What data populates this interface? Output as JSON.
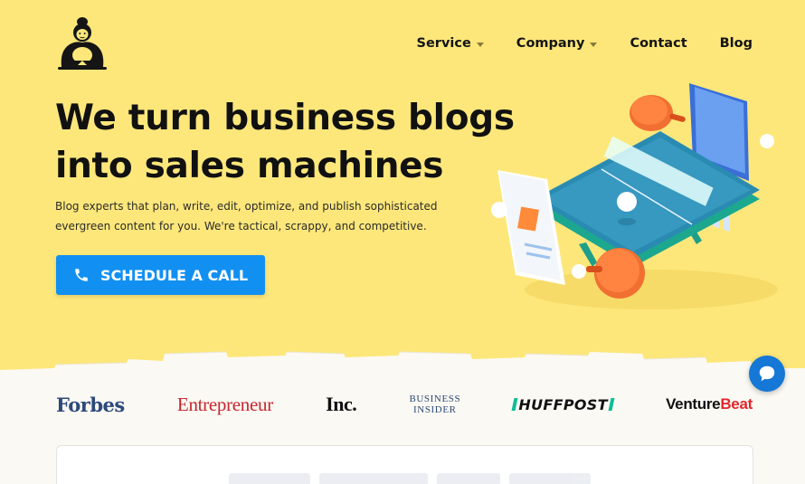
{
  "brand": {
    "logo_icon": "sumo-wrestler-logo-icon"
  },
  "nav": {
    "items": [
      {
        "label": "Service",
        "has_dropdown": true
      },
      {
        "label": "Company",
        "has_dropdown": true
      },
      {
        "label": "Contact",
        "has_dropdown": false
      },
      {
        "label": "Blog",
        "has_dropdown": false
      }
    ]
  },
  "hero": {
    "headline_line1": "We turn business blogs",
    "headline_line2": "into sales machines",
    "subtext_line1": "Blog experts that plan, write, edit, optimize, and publish sophisticated",
    "subtext_line2": "evergreen content for you. We're tactical, scrappy, and competitive.",
    "cta_label": "SCHEDULE A CALL",
    "cta_icon": "phone-icon",
    "illustration_icon": "ping-pong-table-illustration"
  },
  "press": {
    "forbes": "Forbes",
    "entrepreneur": "Entrepreneur",
    "inc": "Inc.",
    "business_insider_line1": "BUSINESS",
    "business_insider_line2": "INSIDER",
    "huffpost": "HUFFPOST",
    "venturebeat_a": "Venture",
    "venturebeat_b": "Beat"
  },
  "chat": {
    "icon": "chat-bubble-icon"
  },
  "colors": {
    "hero_bg": "#fde77a",
    "cta_bg": "#1290f2",
    "chat_bg": "#1577d6",
    "page_bg": "#fbf9f3"
  }
}
